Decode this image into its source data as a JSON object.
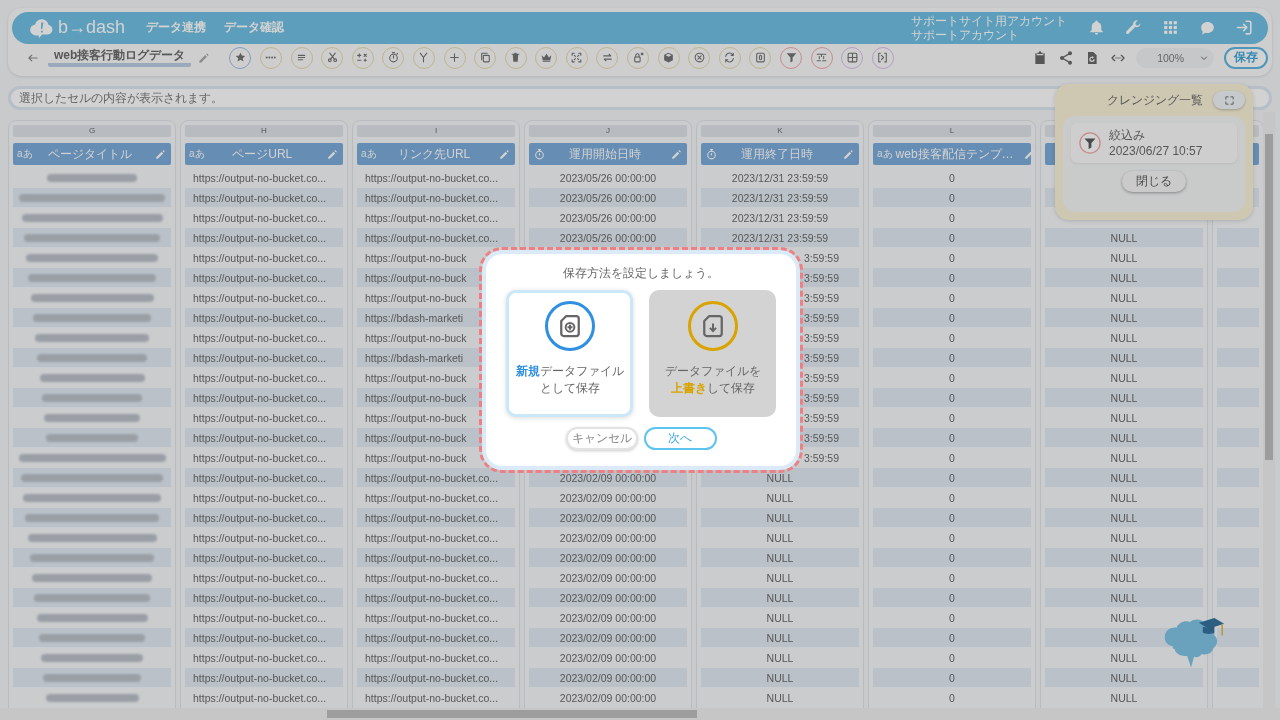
{
  "header": {
    "logo": "b→dash",
    "nav": [
      {
        "label": "データ連携"
      },
      {
        "label": "データ確認"
      }
    ],
    "account": [
      "サポートサイト用アカウント",
      "サポートアカウント"
    ]
  },
  "toolbar": {
    "title": "web接客行動ログデータ",
    "tools": [
      {
        "color": "#849db9"
      },
      {
        "color": "#beb68e"
      },
      {
        "color": "#beb68e"
      },
      {
        "color": "#beb68e"
      },
      {
        "color": "#beb68e"
      },
      {
        "color": "#beb68e"
      },
      {
        "color": "#beb68e"
      },
      {
        "color": "#beb68e"
      },
      {
        "color": "#beb68e"
      },
      {
        "color": "#beb68e"
      },
      {
        "color": "#beb68e"
      },
      {
        "color": "#beb68e"
      },
      {
        "color": "#beb68e"
      },
      {
        "color": "#beb68e"
      },
      {
        "color": "#beb68e"
      },
      {
        "color": "#beb68e"
      },
      {
        "color": "#beb68e"
      },
      {
        "color": "#beb68e"
      },
      {
        "color": "#c88c8c"
      },
      {
        "color": "#c88c8c"
      },
      {
        "color": "#b49fc2"
      },
      {
        "color": "#b49fc2"
      }
    ],
    "zoom": "100%",
    "save": "保存"
  },
  "cell_view": {
    "placeholder": "選択したセルの内容が表示されます。"
  },
  "columns": [
    {
      "letter": "G",
      "title": "ページタイトル",
      "kind": "redacted",
      "badge": "aあ"
    },
    {
      "letter": "H",
      "title": "ページURL",
      "kind": "url",
      "badge": "aあ",
      "cells": [
        "https://output-no-bucket.co...",
        "https://output-no-bucket.co...",
        "https://output-no-bucket.co...",
        "https://output-no-bucket.co...",
        "https://output-no-bucket.co...",
        "https://output-no-bucket.co...",
        "https://output-no-bucket.co...",
        "https://output-no-bucket.co...",
        "https://output-no-bucket.co...",
        "https://output-no-bucket.co...",
        "https://output-no-bucket.co...",
        "https://output-no-bucket.co...",
        "https://output-no-bucket.co...",
        "https://output-no-bucket.co...",
        "https://output-no-bucket.co...",
        "https://output-no-bucket.co...",
        "https://output-no-bucket.co...",
        "https://output-no-bucket.co...",
        "https://output-no-bucket.co...",
        "https://output-no-bucket.co...",
        "https://output-no-bucket.co...",
        "https://output-no-bucket.co...",
        "https://output-no-bucket.co...",
        "https://output-no-bucket.co...",
        "https://output-no-bucket.co...",
        "https://output-no-bucket.co...",
        "https://output-no-bucket.co..."
      ]
    },
    {
      "letter": "I",
      "title": "リンク先URL",
      "kind": "url",
      "badge": "aあ",
      "cells": [
        "https://output-no-bucket.co...",
        "https://output-no-bucket.co...",
        "https://output-no-bucket.co...",
        "https://output-no-bucket.co...",
        "https://output-no-buck",
        "https://output-no-buck",
        "https://output-no-buck",
        "https://bdash-marketi",
        "https://output-no-buck",
        "https://bdash-marketi",
        "https://output-no-buck",
        "https://output-no-buck",
        "https://output-no-buck",
        "https://output-no-buck",
        "https://output-no-buck",
        "https://output-no-bucket.co...",
        "https://output-no-bucket.co...",
        "https://output-no-bucket.co...",
        "https://output-no-bucket.co...",
        "https://output-no-bucket.co...",
        "https://output-no-bucket.co...",
        "https://output-no-bucket.co...",
        "https://output-no-bucket.co...",
        "https://output-no-bucket.co...",
        "https://output-no-bucket.co...",
        "https://output-no-bucket.co...",
        "https://output-no-bucket.co..."
      ]
    },
    {
      "letter": "J",
      "title": "運用開始日時",
      "kind": "datetime",
      "cells": [
        "2023/05/26 00:00:00",
        "2023/05/26 00:00:00",
        "2023/05/26 00:00:00",
        "2023/05/26 00:00:00",
        null,
        null,
        null,
        null,
        null,
        null,
        null,
        null,
        null,
        null,
        null,
        "2023/02/09 00:00:00",
        "2023/02/09 00:00:00",
        "2023/02/09 00:00:00",
        "2023/02/09 00:00:00",
        "2023/02/09 00:00:00",
        "2023/02/09 00:00:00",
        "2023/02/09 00:00:00",
        "2023/02/09 00:00:00",
        "2023/02/09 00:00:00",
        "2023/02/09 00:00:00",
        "2023/02/09 00:00:00",
        "2023/02/09 00:00:00"
      ]
    },
    {
      "letter": "K",
      "title": "運用終了日時",
      "kind": "datetime",
      "cells": [
        "2023/12/31 23:59:59",
        "2023/12/31 23:59:59",
        "2023/12/31 23:59:59",
        "2023/12/31 23:59:59",
        {
          "text": "3:59:59",
          "kind": "clipped"
        },
        {
          "text": "3:59:59",
          "kind": "clipped"
        },
        {
          "text": "3:59:59",
          "kind": "clipped"
        },
        {
          "text": "3:59:59",
          "kind": "clipped"
        },
        {
          "text": "3:59:59",
          "kind": "clipped"
        },
        {
          "text": "3:59:59",
          "kind": "clipped"
        },
        {
          "text": "3:59:59",
          "kind": "clipped"
        },
        {
          "text": "3:59:59",
          "kind": "clipped"
        },
        {
          "text": "3:59:59",
          "kind": "clipped"
        },
        {
          "text": "3:59:59",
          "kind": "clipped"
        },
        {
          "text": "3:59:59",
          "kind": "clipped"
        },
        "NULL",
        "NULL",
        "NULL",
        "NULL",
        "NULL",
        "NULL",
        "NULL",
        "NULL",
        "NULL",
        "NULL",
        "NULL",
        "NULL"
      ]
    },
    {
      "letter": "L",
      "title": "web接客配信テンプ…",
      "kind": "text",
      "badge": "aあ",
      "cells": [
        "0",
        "0",
        "0",
        "0",
        "0",
        "0",
        "0",
        "0",
        "0",
        "0",
        "0",
        "0",
        "0",
        "0",
        "0",
        "0",
        "0",
        "0",
        "0",
        "0",
        "0",
        "0",
        "0",
        "0",
        "0",
        "0",
        "0"
      ]
    },
    {
      "kind": "text",
      "cells": [
        null,
        null,
        null,
        "NULL",
        "NULL",
        "NULL",
        "NULL",
        "NULL",
        "NULL",
        "NULL",
        "NULL",
        "NULL",
        "NULL",
        "NULL",
        "NULL",
        "NULL",
        "NULL",
        "NULL",
        "NULL",
        "NULL",
        "NULL",
        "NULL",
        "NULL",
        "NULL",
        "NULL",
        "NULL",
        "NULL"
      ]
    },
    {
      "kind": "text"
    }
  ],
  "cleansing_panel": {
    "title": "クレンジング一覧",
    "items": [
      {
        "label": "絞込み",
        "date": "2023/06/27 10:57"
      }
    ],
    "close": "閉じる"
  },
  "dialog": {
    "title": "保存方法を設定しましょう。",
    "options": [
      {
        "lines": [
          "**新規**データファイル",
          "として保存"
        ],
        "selected": true,
        "color": "#2f8fe0"
      },
      {
        "lines": [
          "データファイルを",
          "**上書き**して保存"
        ],
        "selected": false,
        "color": "#d9a300"
      }
    ],
    "buttons": [
      {
        "label": "キャンセル",
        "kind": "secondary"
      },
      {
        "label": "次へ",
        "kind": "primary"
      }
    ]
  }
}
